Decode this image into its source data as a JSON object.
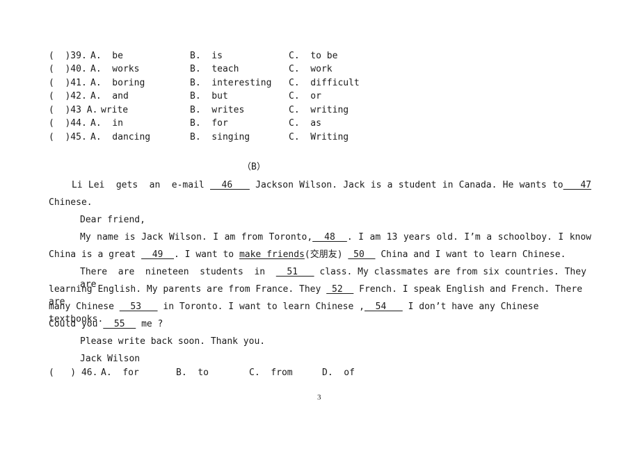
{
  "questions_a": [
    {
      "num": "(  )39.",
      "a": "A.  be",
      "b": "B.  is",
      "c": "C.  to be"
    },
    {
      "num": "(  )40.",
      "a": "A.  works",
      "b": "B.  teach",
      "c": "C.  work"
    },
    {
      "num": "(  )41.",
      "a": "A.  boring",
      "b": "B.  interesting",
      "c": "C.  difficult"
    },
    {
      "num": "(  )42.",
      "a": "A.  and",
      "b": "B.  but",
      "c": "C.  or"
    },
    {
      "num": "(  )43 A.",
      "a": "write",
      "b": "B.  writes",
      "c": "C.  writing"
    },
    {
      "num": "(  )44.",
      "a": "A.  in",
      "b": "B.  for",
      "c": "C.  as"
    },
    {
      "num": "(  )45.",
      "a": "A.  dancing",
      "b": "B.  singing",
      "c": "C.  Writing"
    }
  ],
  "section_b": {
    "title": "（B）",
    "intro_1": "    Li Lei  gets  an  e-mail ",
    "blank_46": "  46   ",
    "intro_2": " Jackson  Wilson.  Jack  is  a  student  in  Canada.  He  wants  to",
    "blank_47": "   47",
    "intro_3": "Chinese.",
    "greeting": "Dear friend,",
    "p1_a": "My name is Jack Wilson. I am from Toronto,",
    "blank_48": "  48  ",
    "p1_b": ". I am 13 years old. I’m a schoolboy. I know",
    "p1_c": "China is a great ",
    "blank_49": "  49  ",
    "p1_d": ". I want to ",
    "make_friends": "make friends",
    "cn_gloss": "(交朋友) ",
    "blank_50": " 50  ",
    "p1_e": " China and I want to learn Chinese.",
    "p2_a": "There  are  nineteen  students  in  ",
    "blank_51": "  51   ",
    "p2_b": "  class.  My classmates  are  from  six  countries.  They  are",
    "p2_c": "learning English. My parents are from France. They ",
    "blank_52": " 52  ",
    "p2_d": " French. I speak English and French. There are",
    "p2_e": "many Chinese ",
    "blank_53": "  53   ",
    "p2_f": " in Toronto. I want to learn Chinese ,",
    "blank_54": "  54   ",
    "p2_g": " I don’t have any Chinese textbooks.",
    "p2_h": "Could you ",
    "blank_55": "  55  ",
    "p2_i": " me ?",
    "closing": "Please write back soon. Thank you.",
    "signature": "Jack Wilson"
  },
  "question_46": {
    "num": "(   ) 46.",
    "a": "A.  for",
    "b": "B.  to",
    "c": "C.  from",
    "d": "D.  of"
  },
  "page_number": "3"
}
